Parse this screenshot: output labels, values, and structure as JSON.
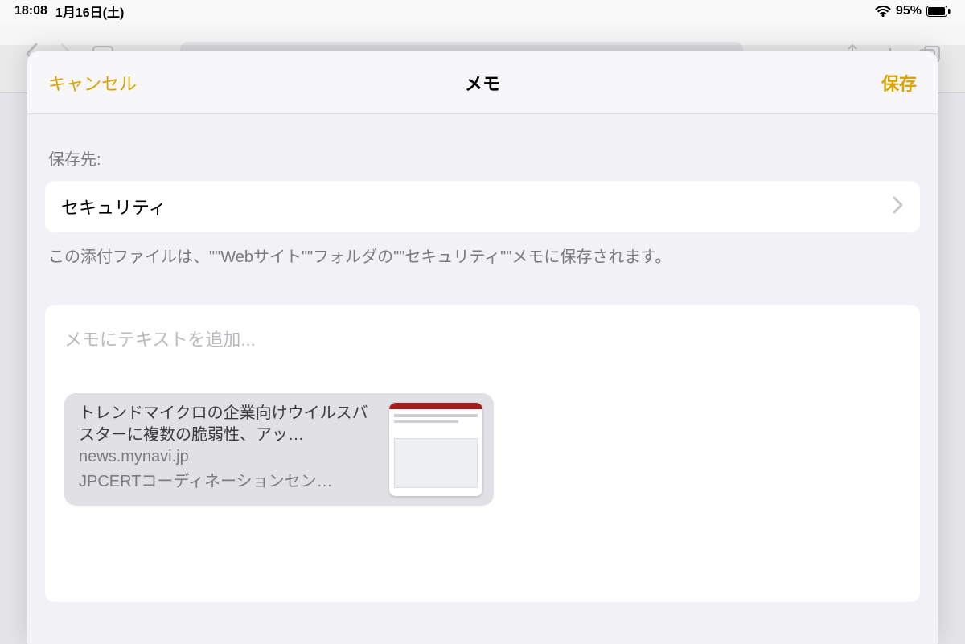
{
  "status": {
    "time": "18:08",
    "date": "1月16日(土)",
    "battery_pct": "95%"
  },
  "sheet": {
    "cancel_label": "キャンセル",
    "title": "メモ",
    "save_label": "保存",
    "destination_label": "保存先:",
    "destination_value": "セキュリティ",
    "explain_text": "この添付ファイルは、\"\"Webサイト\"\"フォルダの\"\"セキュリティ\"\"メモに保存されます。",
    "note_placeholder": "メモにテキストを追加...",
    "link": {
      "title": "トレンドマイクロの企業向けウイルスバスターに複数の脆弱性、アッ…",
      "domain": "news.mynavi.jp",
      "desc": "JPCERTコーディネーションセン…"
    }
  }
}
